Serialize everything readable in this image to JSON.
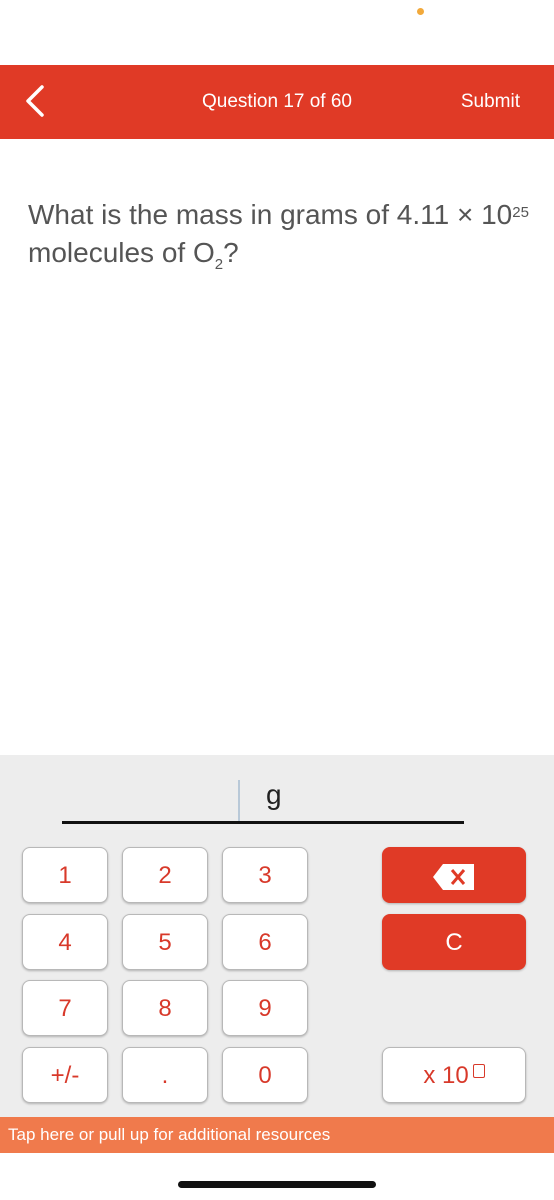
{
  "header": {
    "title": "Question 17 of 60",
    "submit_label": "Submit",
    "back_icon": "chevron-left-icon"
  },
  "question": {
    "text_before": "What is the mass in grams of  4.11 × 10",
    "exponent": "25",
    "text_middle": " molecules of O",
    "subscript": "2",
    "text_after": "?"
  },
  "answer": {
    "value": "",
    "unit": "g"
  },
  "keypad": {
    "keys": [
      "1",
      "2",
      "3",
      "4",
      "5",
      "6",
      "7",
      "8",
      "9",
      "+/-",
      ".",
      "0"
    ],
    "backspace_icon": "backspace-icon",
    "clear_label": "C",
    "x10_label": "x 10"
  },
  "resources_bar": {
    "label": "Tap here or pull up for additional resources"
  },
  "colors": {
    "accent": "#e03a26",
    "resources": "#f07a4c",
    "key_text": "#d8392a"
  }
}
